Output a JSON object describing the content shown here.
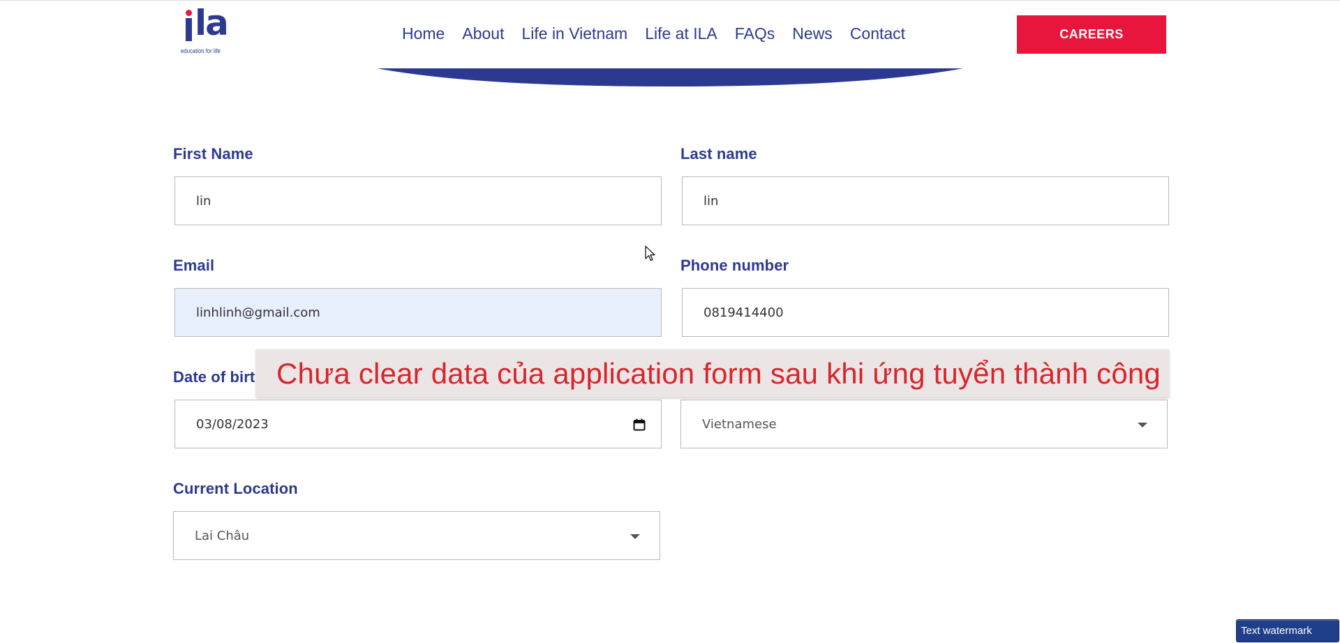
{
  "header": {
    "logo": {
      "wordmark": "ila",
      "tagline": "education for life"
    },
    "nav": [
      {
        "label": "Home"
      },
      {
        "label": "About"
      },
      {
        "label": "Life in Vietnam"
      },
      {
        "label": "Life at ILA"
      },
      {
        "label": "FAQs"
      },
      {
        "label": "News"
      },
      {
        "label": "Contact"
      }
    ],
    "careers_label": "CAREERS"
  },
  "form": {
    "first_name": {
      "label": "First Name",
      "value": "lin"
    },
    "last_name": {
      "label": "Last name",
      "value": "lin"
    },
    "email": {
      "label": "Email",
      "value": "linhlinh@gmail.com"
    },
    "phone": {
      "label": "Phone number",
      "value": "0819414400"
    },
    "dob": {
      "label": "Date of birt",
      "value": "03/08/2023"
    },
    "nationality": {
      "selected": "Vietnamese"
    },
    "location": {
      "label": "Current Location",
      "selected": "Lai Châu"
    }
  },
  "overlay_caption": "Chưa clear data của application form sau khi ứng tuyển thành công",
  "watermark": "Text watermark",
  "colors": {
    "brand_navy": "#2b3990",
    "brand_red": "#e8163d",
    "caption_red": "#d6262c",
    "autofill_blue": "#e8f0fe"
  },
  "icons": [
    "calendar-icon",
    "chevron-down-icon",
    "mouse-cursor-icon"
  ]
}
